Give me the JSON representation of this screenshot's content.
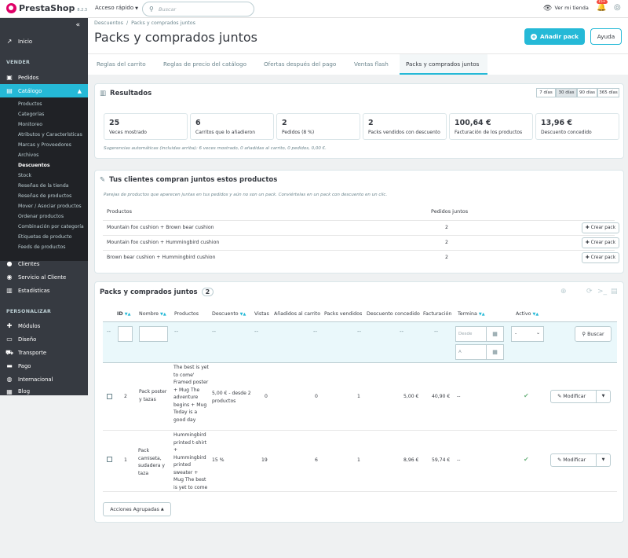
{
  "header": {
    "logo_text": "PrestaShop",
    "version": "8.2.3",
    "quick_access": "Acceso rápido",
    "search_placeholder": "Buscar",
    "view_shop": "Ver mi tienda",
    "notifications_count": "15+"
  },
  "sidebar": {
    "inicio": "Inicio",
    "section_vender": "VENDER",
    "pedidos": "Pedidos",
    "catalogo": "Catálogo",
    "submenu": [
      "Productos",
      "Categorías",
      "Monitoreo",
      "Atributos y Características",
      "Marcas y Proveedores",
      "Archivos",
      "Descuentos",
      "Stock",
      "Reseñas de la tienda",
      "Reseñas de productos",
      "Mover / Asociar productos",
      "Ordenar productos",
      "Combinación por categoría",
      "Etiquetas de producto",
      "Feeds de productos"
    ],
    "clientes": "Clientes",
    "servicio": "Servicio al Cliente",
    "estadisticas": "Estadísticas",
    "section_personalizar": "PERSONALIZAR",
    "modulos": "Módulos",
    "diseno": "Diseño",
    "transporte": "Transporte",
    "pago": "Pago",
    "internacional": "Internacional",
    "blog": "Blog"
  },
  "page": {
    "breadcrumb_parent": "Descuentos",
    "breadcrumb_current": "Packs y comprados juntos",
    "title": "Packs y comprados juntos",
    "add_pack": "Añadir pack",
    "help": "Ayuda"
  },
  "tabs": [
    "Reglas del carrito",
    "Reglas de precio del catálogo",
    "Ofertas después del pago",
    "Ventas flash",
    "Packs y comprados juntos"
  ],
  "results": {
    "title": "Resultados",
    "ranges": [
      "7 días",
      "30 días",
      "90 días",
      "365 días"
    ],
    "kpis": [
      {
        "value": "25",
        "label": "Veces mostrado"
      },
      {
        "value": "6",
        "label": "Carritos que lo añadieron"
      },
      {
        "value": "2",
        "label": "Pedidos (8 %)"
      },
      {
        "value": "2",
        "label": "Packs vendidos con descuento"
      },
      {
        "value": "100,64 €",
        "label": "Facturación de los productos"
      },
      {
        "value": "13,96 €",
        "label": "Descuento concedido"
      }
    ],
    "hint": "Sugerencias automáticas (incluidas arriba): 6 veces mostrado, 0 añadidas al carrito, 0 pedidos, 0,00 €."
  },
  "together": {
    "title": "Tus clientes compran juntos estos productos",
    "subtitle": "Parejas de productos que aparecen juntas en tus pedidos y aún no son un pack. Conviértelas en un pack con descuento en un clic.",
    "col_products": "Productos",
    "col_orders": "Pedidos juntos",
    "button": "Crear pack",
    "rows": [
      {
        "name": "Mountain fox cushion + Brown bear cushion",
        "count": "2"
      },
      {
        "name": "Mountain fox cushion + Hummingbird cushion",
        "count": "2"
      },
      {
        "name": "Brown bear cushion + Hummingbird cushion",
        "count": "2"
      }
    ]
  },
  "packs": {
    "title": "Packs y comprados juntos",
    "count": "2",
    "columns": [
      "ID",
      "Nombre",
      "Productos",
      "Descuento",
      "Vistas",
      "Añadidos al carrito",
      "Packs vendidos",
      "Descuento concedido",
      "Facturación",
      "Termina",
      "Activo"
    ],
    "filter_from": "Desde",
    "filter_to": "A",
    "filter_select": "-",
    "filter_dash": "--",
    "search": "Buscar",
    "rows": [
      {
        "id": "2",
        "name": "Pack poster y tazas",
        "products": "The best is yet to come' Framed poster + Mug The adventure begins + Mug Today is a good day",
        "discount": "5,00 € - desde 2 productos",
        "views": "0",
        "added": "0",
        "sold": "1",
        "granted": "5,00 €",
        "revenue": "40,90 €",
        "ends": "--"
      },
      {
        "id": "1",
        "name": "Pack camiseta, sudadera y taza",
        "products": "Hummingbird printed t-shirt + Hummingbird printed sweater + Mug The best is yet to come",
        "discount": "15 %",
        "views": "19",
        "added": "6",
        "sold": "1",
        "granted": "8,96 €",
        "revenue": "59,74 €",
        "ends": "--"
      }
    ],
    "modify": "Modificar",
    "bulk": "Acciones Agrupadas"
  }
}
